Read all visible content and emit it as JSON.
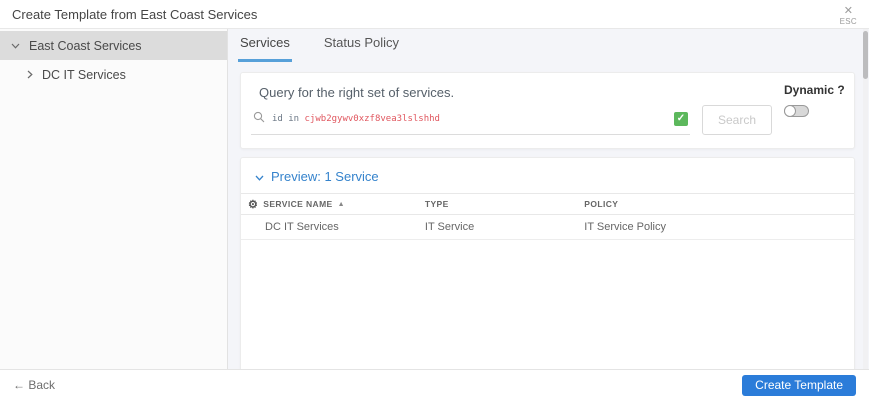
{
  "header": {
    "title": "Create Template from East Coast Services",
    "close_icon": "✕",
    "close_label": "ESC"
  },
  "sidebar": {
    "items": [
      {
        "label": "East Coast Services",
        "expanded": true,
        "selected": true
      },
      {
        "label": "DC IT Services",
        "expanded": false,
        "selected": false
      }
    ]
  },
  "tabs": [
    {
      "label": "Services",
      "active": true
    },
    {
      "label": "Status Policy",
      "active": false
    }
  ],
  "query": {
    "instruction": "Query for the right set of services.",
    "prefix": "id in",
    "value": "cjwb2gywv0xzf8vea3lslshhd",
    "valid": true,
    "search_label": "Search",
    "dynamic_label": "Dynamic ?",
    "dynamic_on": false
  },
  "preview": {
    "heading": "Preview: 1 Service",
    "table": {
      "columns": [
        "SERVICE NAME",
        "TYPE",
        "POLICY"
      ],
      "rows": [
        [
          "DC IT Services",
          "IT Service",
          "IT Service Policy"
        ]
      ]
    }
  },
  "footer": {
    "back_label": "← Back",
    "create_label": "Create Template"
  },
  "icons": {
    "gear": "⚙",
    "sort_asc": "▲",
    "check": "✓"
  },
  "colors": {
    "accent_blue": "#2b7cd9",
    "tab_underline": "#57a0d9",
    "valid_green": "#5cb85c",
    "query_value_red": "#e0565e",
    "selected_row_gray": "#dcdcdc"
  }
}
